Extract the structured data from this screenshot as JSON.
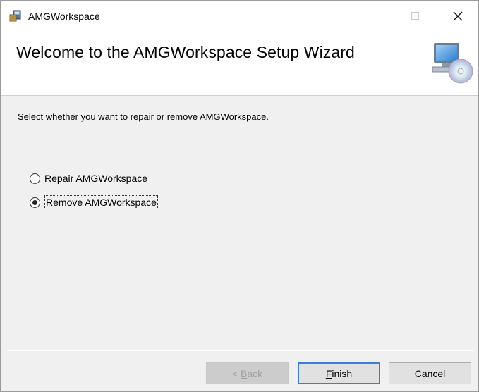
{
  "window": {
    "title": "AMGWorkspace",
    "controls": {
      "minimize": "minimize",
      "maximize": "maximize",
      "close": "close"
    }
  },
  "banner": {
    "title": "Welcome to the AMGWorkspace Setup Wizard",
    "icon": "computer-cd-icon"
  },
  "content": {
    "instruction": "Select whether you want to repair or remove AMGWorkspace.",
    "options": [
      {
        "accel": "R",
        "rest": "epair AMGWorkspace",
        "selected": false
      },
      {
        "accel": "R",
        "rest": "emove AMGWorkspace",
        "selected": true
      }
    ]
  },
  "buttons": {
    "back": {
      "prefix": "< ",
      "accel": "B",
      "rest": "ack",
      "enabled": false
    },
    "finish": {
      "accel": "F",
      "rest": "inish"
    },
    "cancel": {
      "label": "Cancel"
    }
  },
  "colors": {
    "focus_border": "#3b7ddc",
    "dialog_bg": "#f0f0f0"
  }
}
